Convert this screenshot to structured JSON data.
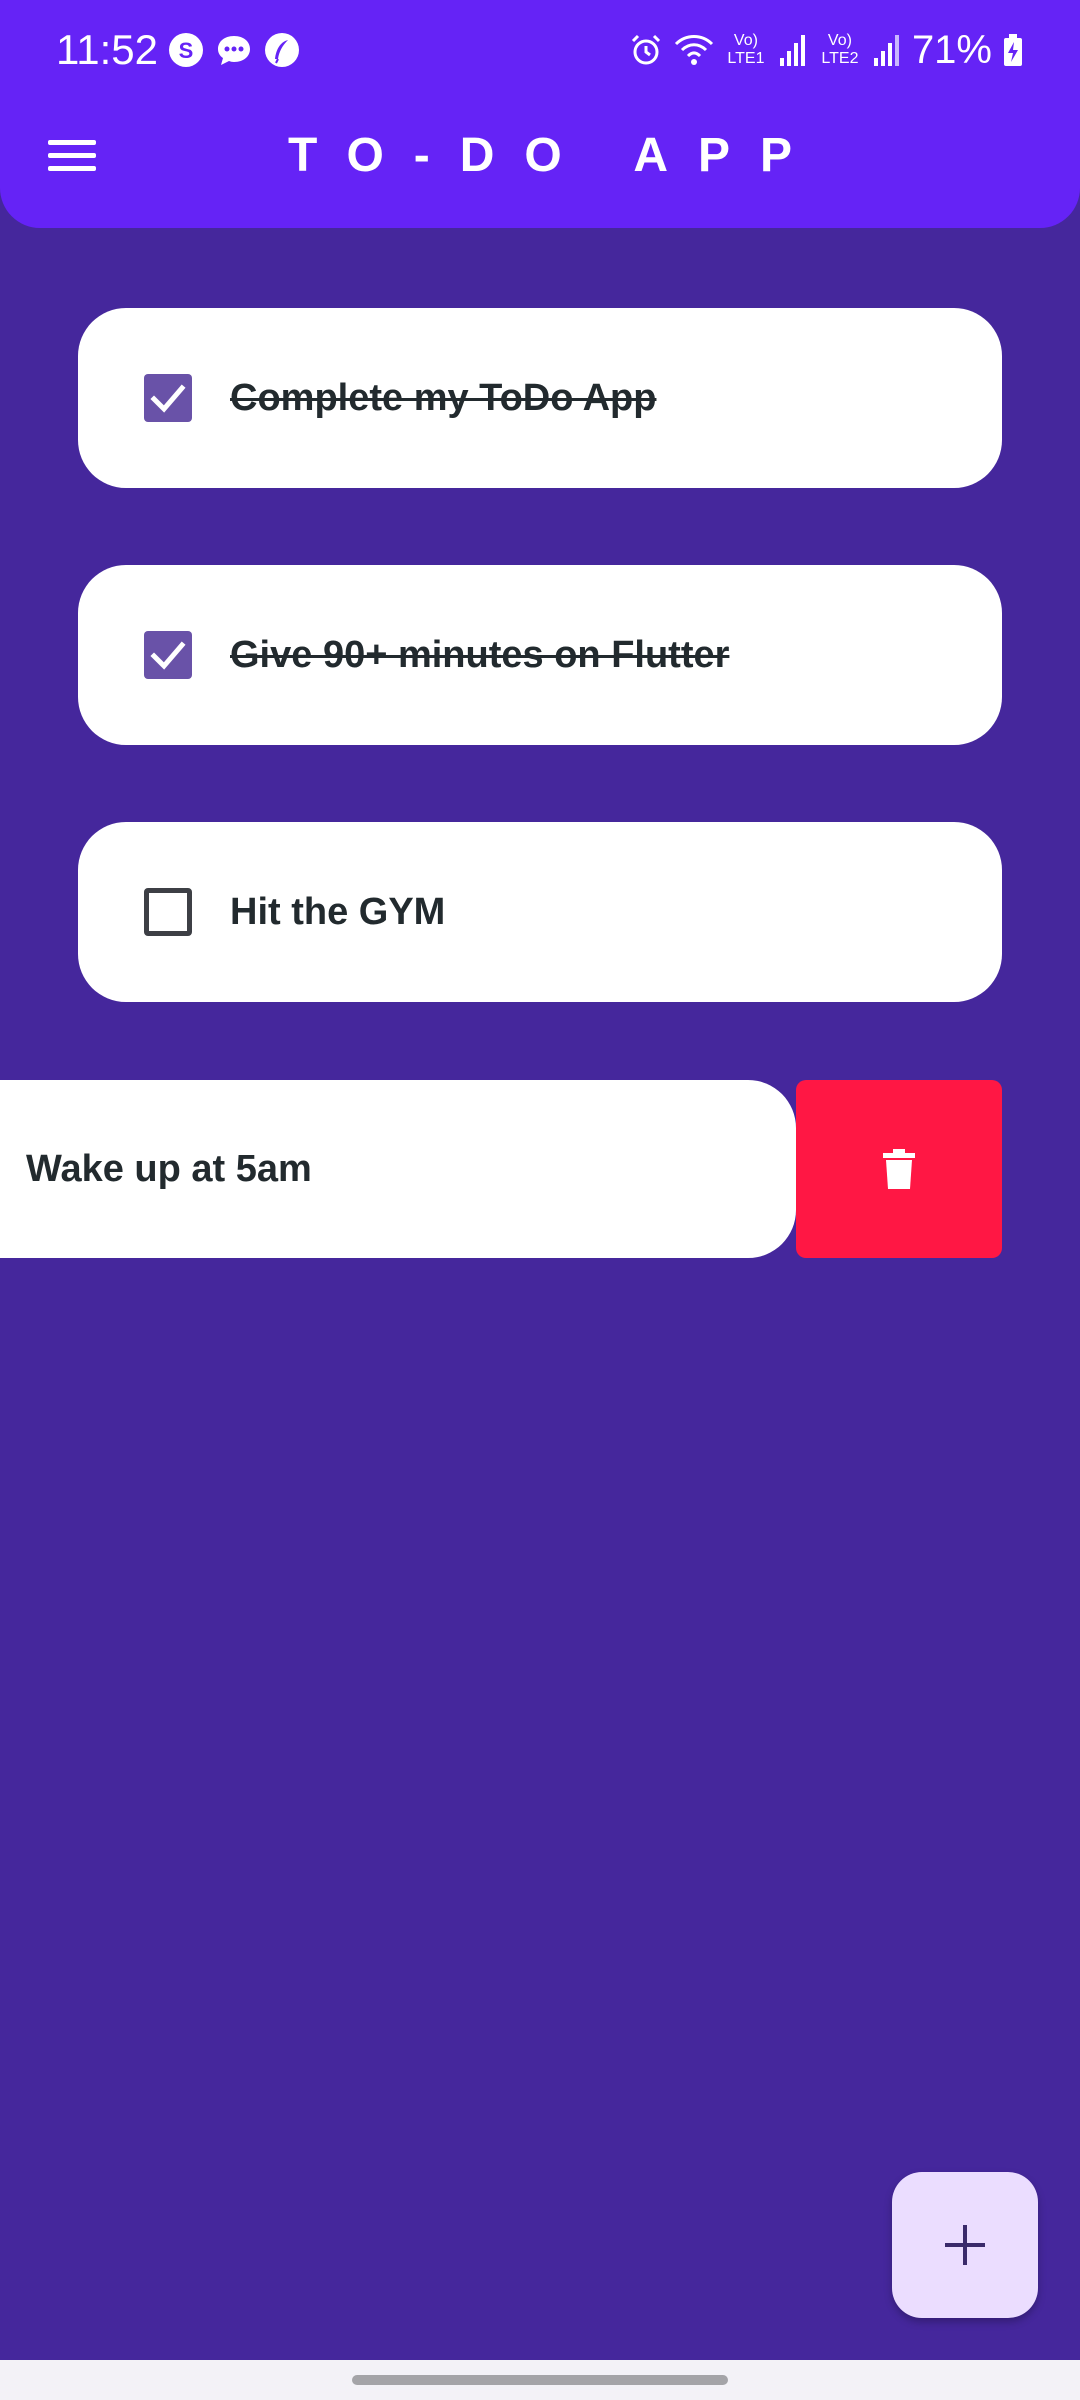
{
  "status_bar": {
    "time": "11:52",
    "left_icons": [
      "s-app-icon",
      "messages-icon",
      "feather-app-icon"
    ],
    "sim1_label": "Vo) LTE1",
    "sim2_label": "Vo) LTE2",
    "battery": "71%"
  },
  "header": {
    "title": "TO-DO APP",
    "menu_icon": "hamburger-menu-icon"
  },
  "todos": [
    {
      "text": "Complete my ToDo App",
      "completed": true
    },
    {
      "text": "Give 90+ minutes on Flutter",
      "completed": true
    },
    {
      "text": "Hit the GYM",
      "completed": false
    },
    {
      "text": "Wake up at 5am",
      "completed": false,
      "swiped": true
    }
  ],
  "delete_action": {
    "icon": "trash-icon"
  },
  "fab": {
    "icon": "plus-icon"
  },
  "colors": {
    "header": "#6523f6",
    "background": "#45279c",
    "card": "#ffffff",
    "checkbox_checked": "#6952a8",
    "delete": "#ff1744",
    "fab": "#ebddff",
    "text": "#222a2e"
  }
}
